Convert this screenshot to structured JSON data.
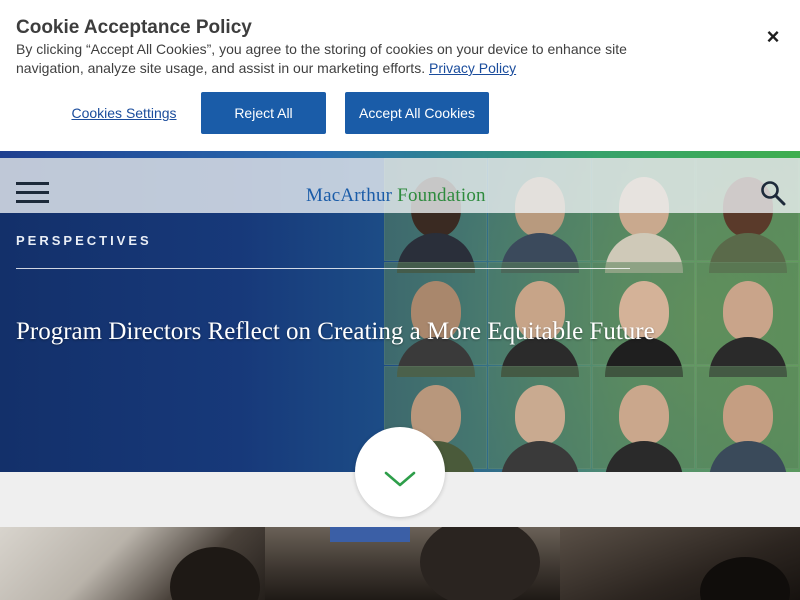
{
  "cookie_banner": {
    "title": "Cookie Acceptance Policy",
    "text": "By clicking “Accept All Cookies”, you agree to the storing of cookies on your device to enhance site navigation, analyze site usage, and assist in our marketing efforts.",
    "privacy_link": "Privacy Policy",
    "close_label": "×",
    "settings_label": "Cookies Settings",
    "reject_label": "Reject All",
    "accept_label": "Accept All Cookies"
  },
  "header": {
    "logo_primary": "MacArthur",
    "logo_secondary": "Foundation",
    "menu_icon": "hamburger-menu-icon",
    "search_icon": "search-icon"
  },
  "hero": {
    "kicker": "PERSPECTIVES",
    "headline": "Program Directors Reflect on Creating a More Equitable Future",
    "scroll_icon": "chevron-down-icon"
  },
  "colors": {
    "brand_blue": "#1a5ca8",
    "brand_green": "#2e8b3e",
    "hero_navy": "#16346e",
    "button_blue": "#1a5ca8"
  }
}
